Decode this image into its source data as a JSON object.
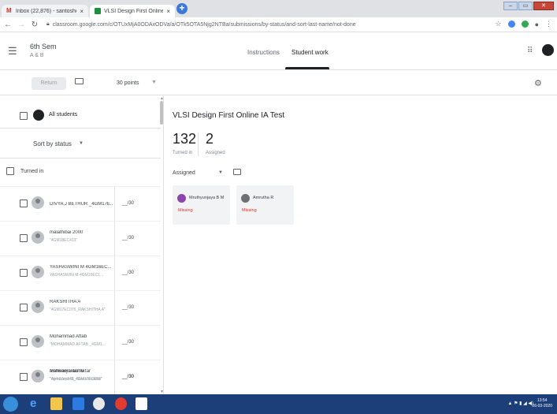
{
  "browser": {
    "tabs": [
      {
        "title": "Inbox (22,876) - santoshec0450@...",
        "close": "×"
      },
      {
        "title": "VLSI Design First Online IA Test",
        "close": "×"
      }
    ],
    "url": "classroom.google.com/c/OTUxMjA0ODAxODVa/a/OTk5OTA5Njg2NTBa/submissions/by-status/and-sort-last-name/not-done"
  },
  "header": {
    "class_name": "6th Sem",
    "section": "A & B",
    "tabs": [
      "Instructions",
      "Student work"
    ],
    "active_tab": "Student work"
  },
  "toolbar": {
    "return_label": "Return",
    "points": "30 points"
  },
  "left_panel": {
    "all_students_label": "All students",
    "sort_label": "Sort by status",
    "section_label": "Turned in",
    "students": [
      {
        "name": "DIVYA J BETHUR _4GM17E...",
        "sub": "",
        "grade": "__/30",
        "photo": false
      },
      {
        "name": "malathibai 2000",
        "sub": "\"4GM18EC413\"",
        "grade": "__/30",
        "photo": false
      },
      {
        "name": "YASHASWINI M 4GM16EC...",
        "sub": "YASHASWINI M 4GM16EC1...",
        "grade": "__/30",
        "photo": false
      },
      {
        "name": "RAKSHITHA A",
        "sub": "\"4GM17EC075_RAKSHITHA A\"",
        "grade": "__/30",
        "photo": false
      },
      {
        "name": "Mohammad Aftab",
        "sub": "\"MOHAMMAD AFTAB _4GM1...",
        "grade": "__/30",
        "photo": false
      },
      {
        "name": "aishwarya aishu",
        "sub": "\"Aishwarya G_4GM17EC003\"",
        "grade": "__/30",
        "photo": true
      },
      {
        "name": "Mansooraktar Aktar",
        "sub": "\"4gm17ec046_ Mansooraktar\"",
        "grade": "__/30",
        "photo": false
      }
    ]
  },
  "main": {
    "assignment_title": "VLSI Design First Online IA Test",
    "turned_in_count": "132",
    "turned_in_label": "Turned in",
    "assigned_count": "2",
    "assigned_label": "Assigned",
    "filter_label": "Assigned",
    "cards": [
      {
        "name": "Mruthyunjaya B M",
        "status": "Missing"
      },
      {
        "name": "Amrutha R",
        "status": "Missing"
      }
    ]
  },
  "taskbar": {
    "time": "13:54",
    "date": "06-03-2020"
  },
  "colors": {
    "missing": "#d93025",
    "taskbar": "#1c3f7a"
  }
}
